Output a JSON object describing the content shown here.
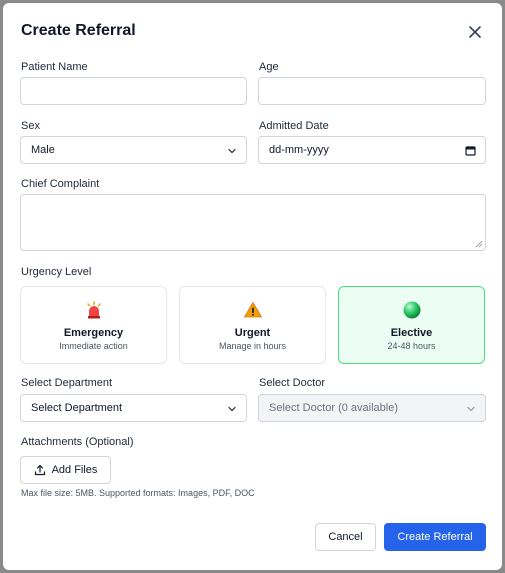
{
  "modal": {
    "title": "Create Referral"
  },
  "form": {
    "patient_name": {
      "label": "Patient Name",
      "value": ""
    },
    "age": {
      "label": "Age",
      "value": ""
    },
    "sex": {
      "label": "Sex",
      "value": "Male"
    },
    "admitted_date": {
      "label": "Admitted Date",
      "value": "dd-mm-yyyy"
    },
    "chief_complaint": {
      "label": "Chief Complaint",
      "value": ""
    },
    "urgency": {
      "label": "Urgency Level",
      "options": [
        {
          "title": "Emergency",
          "subtitle": "Immediate action",
          "icon": "siren-icon",
          "selected": false
        },
        {
          "title": "Urgent",
          "subtitle": "Manage in hours",
          "icon": "warning-icon",
          "selected": false
        },
        {
          "title": "Elective",
          "subtitle": "24-48 hours",
          "icon": "green-circle-icon",
          "selected": true
        }
      ]
    },
    "department": {
      "label": "Select Department",
      "value": "Select Department"
    },
    "doctor": {
      "label": "Select Doctor",
      "value": "Select Doctor (0 available)"
    },
    "attachments": {
      "label": "Attachments (Optional)",
      "button": "Add Files",
      "hint": "Max file size: 5MB. Supported formats: Images, PDF, DOC"
    }
  },
  "actions": {
    "cancel": "Cancel",
    "create": "Create Referral"
  },
  "colors": {
    "primary": "#2563eb",
    "selected_bg": "#ecfdf3",
    "selected_border": "#4ade80",
    "backdrop": "#8a8a8a"
  }
}
